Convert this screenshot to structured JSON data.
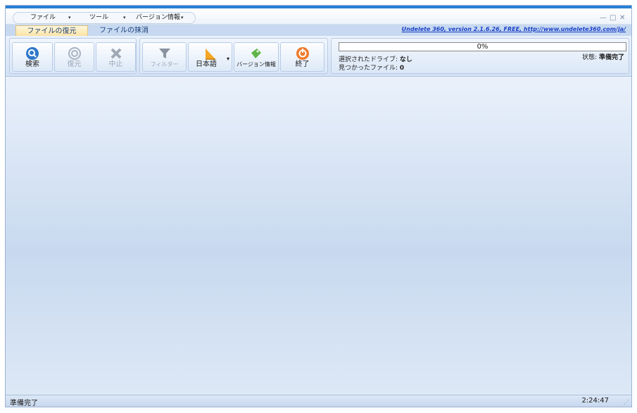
{
  "menubar": {
    "items": [
      "ファイル",
      "ツール",
      "バージョン情報"
    ],
    "window_controls": [
      "minimize-icon",
      "maximize-icon",
      "close-icon"
    ]
  },
  "tabs": [
    {
      "label": "ファイルの復元",
      "active": true
    },
    {
      "label": "ファイルの抹消",
      "active": false
    }
  ],
  "header_link": "Undelete 360, version 2.1.6.26, FREE, http://www.undelete360.com/ja/",
  "toolbar": {
    "buttons": [
      {
        "label": "検索",
        "icon": "search-icon",
        "enabled": true
      },
      {
        "label": "復元",
        "icon": "recover-icon",
        "enabled": false
      },
      {
        "label": "中止",
        "icon": "stop-icon",
        "enabled": false
      },
      {
        "label": "フィルター",
        "icon": "filter-icon",
        "enabled": false
      },
      {
        "label": "日本語",
        "icon": "language-icon",
        "enabled": true
      },
      {
        "label": "バージョン情報",
        "icon": "version-icon",
        "enabled": true
      },
      {
        "label": "終了",
        "icon": "exit-icon",
        "enabled": true
      }
    ]
  },
  "progress": {
    "text": "0%",
    "value": 0
  },
  "info": {
    "drive_label": "選択されたドライブ:",
    "drive_value": "なし",
    "found_label": "見つかったファイル:",
    "found_value": "0",
    "state_label": "状態:",
    "state_value": "準備完了"
  },
  "status": {
    "left": "準備完了",
    "time": "2:24:47"
  },
  "colors": {
    "accent": "#2a7fd4",
    "link": "#1a3fc7",
    "tab_active": "#fbe3a6",
    "exit_icon": "#f07a2a"
  }
}
